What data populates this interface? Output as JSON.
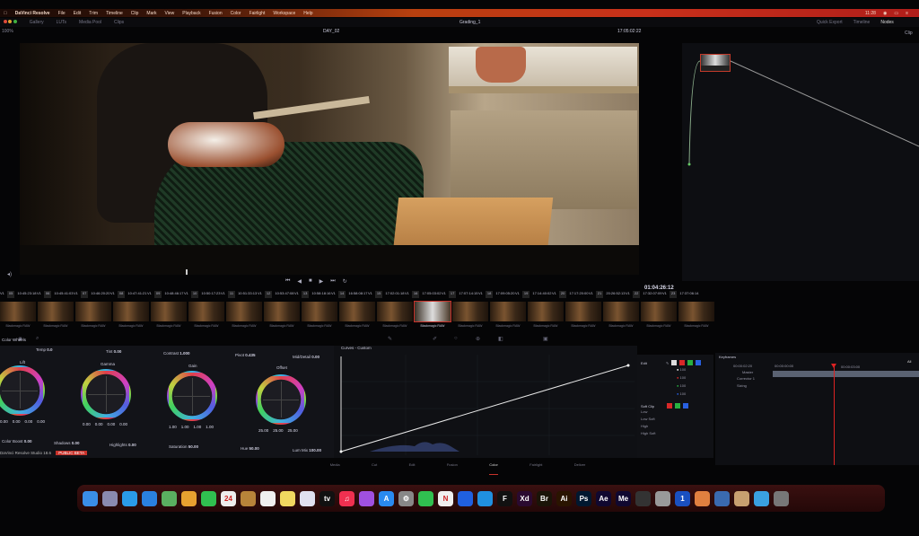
{
  "menubar": {
    "apple": "",
    "app": "DaVinci Resolve",
    "items": [
      "File",
      "Edit",
      "Trim",
      "Timeline",
      "Clip",
      "Mark",
      "View",
      "Playback",
      "Fusion",
      "Color",
      "Fairlight",
      "Workspace",
      "Help"
    ],
    "clock": "11:28",
    "accent": "#c8301a"
  },
  "toolbar": {
    "items": [
      "Gallery",
      "LUTs",
      "Media Pool",
      "Clips"
    ],
    "project": "Grading_1",
    "right_items": [
      "Quick Export",
      "Timeline",
      "Nodes"
    ],
    "clip_label": "Clip"
  },
  "viewer": {
    "timeline_name": "DAY_02",
    "source_timecode": "17:05:02:22",
    "zoom": "100%"
  },
  "timeline": {
    "timecode": "01:04:26:12",
    "clips": [
      {
        "num": "05",
        "tc": "10:45:23:18"
      },
      {
        "num": "06",
        "tc": "10:45:41:03"
      },
      {
        "num": "07",
        "tc": "10:46:20:20"
      },
      {
        "num": "08",
        "tc": "10:47:41:21"
      },
      {
        "num": "09",
        "tc": "10:48:46:17"
      },
      {
        "num": "10",
        "tc": "10:50:17:23"
      },
      {
        "num": "11",
        "tc": "10:51:33:13"
      },
      {
        "num": "12",
        "tc": "10:53:47:08"
      },
      {
        "num": "13",
        "tc": "10:58:18:16"
      },
      {
        "num": "14",
        "tc": "16:58:08:17"
      },
      {
        "num": "15",
        "tc": "17:02:01:18"
      },
      {
        "num": "16",
        "tc": "17:05:03:02"
      },
      {
        "num": "17",
        "tc": "17:07:14:15"
      },
      {
        "num": "18",
        "tc": "17:09:05:20"
      },
      {
        "num": "19",
        "tc": "17:14:40:02"
      },
      {
        "num": "20",
        "tc": "17:17:20:00"
      },
      {
        "num": "21",
        "tc": "20:26:52:13"
      },
      {
        "num": "22",
        "tc": "17:32:07:09"
      },
      {
        "num": "23",
        "tc": "17:37:06:14"
      }
    ],
    "clip_label": "Blackmagic RAW",
    "selected_index": 11
  },
  "color_wheels": {
    "title": "Color Wheels",
    "params_top": [
      {
        "label": "Temp",
        "value": "0.0"
      },
      {
        "label": "Tint",
        "value": "0.00"
      },
      {
        "label": "Contrast",
        "value": "1.000"
      },
      {
        "label": "Pivot",
        "value": "0.435"
      },
      {
        "label": "Mid/Detail",
        "value": "0.00"
      }
    ],
    "wheels": [
      {
        "name": "Lift",
        "values": [
          "0.00",
          "0.00",
          "0.00",
          "0.00"
        ]
      },
      {
        "name": "Gamma",
        "values": [
          "0.00",
          "0.00",
          "0.00",
          "0.00"
        ]
      },
      {
        "name": "Gain",
        "values": [
          "1.00",
          "1.00",
          "1.00",
          "1.00"
        ]
      },
      {
        "name": "Offset",
        "values": [
          "25.00",
          "25.00",
          "25.00"
        ]
      }
    ],
    "params_bottom": [
      {
        "label": "Color Boost",
        "value": "0.00"
      },
      {
        "label": "Shadows",
        "value": "0.00"
      },
      {
        "label": "Highlights",
        "value": "0.00"
      },
      {
        "label": "Saturation",
        "value": "50.00"
      },
      {
        "label": "Hue",
        "value": "50.00"
      },
      {
        "label": "Lum Mix",
        "value": "100.00"
      }
    ]
  },
  "curves": {
    "title": "Curves - Custom"
  },
  "curve_controls": {
    "edit_label": "Edit",
    "values": [
      "100",
      "100",
      "100",
      "100"
    ],
    "soft_clip": "Soft Clip",
    "soft_labels": [
      "Low",
      "Low Soft",
      "High",
      "High Soft"
    ]
  },
  "keyframes": {
    "title": "Keyframes",
    "timecode": "00:00:02:20",
    "filter": "All",
    "master": "Master",
    "tracks": [
      "Corrector 1",
      "Sizing"
    ],
    "ruler": [
      "00:00:00:00",
      "00:00:03:00"
    ]
  },
  "pages": {
    "items": [
      "Media",
      "Cut",
      "Edit",
      "Fusion",
      "Color",
      "Fairlight",
      "Deliver"
    ],
    "active": "Color"
  },
  "status": {
    "app_version": "DaVinci Resolve Studio 18.6",
    "badge": "PUBLIC BETA"
  },
  "dock": {
    "apps": [
      {
        "name": "finder",
        "color": "#3a8ee8",
        "text": ""
      },
      {
        "name": "launchpad",
        "color": "#8a8ab0",
        "text": ""
      },
      {
        "name": "safari",
        "color": "#2a9ae8",
        "text": ""
      },
      {
        "name": "mail",
        "color": "#2a80e0",
        "text": ""
      },
      {
        "name": "maps",
        "color": "#5ab060",
        "text": ""
      },
      {
        "name": "photos",
        "color": "#e8a030",
        "text": ""
      },
      {
        "name": "facetime",
        "color": "#30c050",
        "text": ""
      },
      {
        "name": "calendar",
        "color": "#eeeeee",
        "text": "24"
      },
      {
        "name": "notes-brown",
        "color": "#b8843a",
        "text": ""
      },
      {
        "name": "reminders",
        "color": "#f0f0f0",
        "text": ""
      },
      {
        "name": "notes",
        "color": "#f0d860",
        "text": ""
      },
      {
        "name": "freeform",
        "color": "#e0e0f0",
        "text": ""
      },
      {
        "name": "apple-tv",
        "color": "#111111",
        "text": "tv"
      },
      {
        "name": "music",
        "color": "#f03050",
        "text": "♫"
      },
      {
        "name": "podcasts",
        "color": "#a050e0",
        "text": ""
      },
      {
        "name": "app-store",
        "color": "#2a8af0",
        "text": "A"
      },
      {
        "name": "system-settings",
        "color": "#888888",
        "text": "⚙"
      },
      {
        "name": "messages",
        "color": "#30c050",
        "text": ""
      },
      {
        "name": "notion",
        "color": "#f0f0f0",
        "text": "N"
      },
      {
        "name": "app-blue",
        "color": "#2060e0",
        "text": ""
      },
      {
        "name": "app-cyan",
        "color": "#2090e0",
        "text": ""
      },
      {
        "name": "figma",
        "color": "#111111",
        "text": "F"
      },
      {
        "name": "adobe-xd",
        "color": "#2a0a30",
        "text": "Xd"
      },
      {
        "name": "adobe-bridge",
        "color": "#1a1408",
        "text": "Br"
      },
      {
        "name": "adobe-illustrator",
        "color": "#2a1400",
        "text": "Ai"
      },
      {
        "name": "adobe-photoshop",
        "color": "#001830",
        "text": "Ps"
      },
      {
        "name": "adobe-after-effects",
        "color": "#100830",
        "text": "Ae"
      },
      {
        "name": "adobe-media-encoder",
        "color": "#100830",
        "text": "Me"
      },
      {
        "name": "davinci-resolve",
        "color": "#333333",
        "text": ""
      },
      {
        "name": "app-gray",
        "color": "#999999",
        "text": ""
      },
      {
        "name": "1password",
        "color": "#1a50c0",
        "text": "1"
      },
      {
        "name": "app-orange",
        "color": "#e08040",
        "text": ""
      },
      {
        "name": "quicktime",
        "color": "#3a6ab0",
        "text": ""
      },
      {
        "name": "preview",
        "color": "#c8a070",
        "text": ""
      },
      {
        "name": "downloads-folder",
        "color": "#3aa0e0",
        "text": ""
      },
      {
        "name": "trash",
        "color": "#777777",
        "text": ""
      }
    ]
  }
}
